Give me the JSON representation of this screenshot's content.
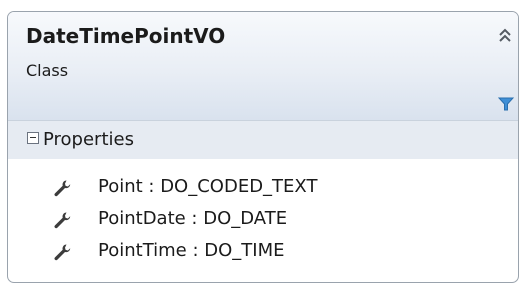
{
  "class": {
    "name": "DateTimePointVO",
    "stereotype": "Class"
  },
  "icons": {
    "collapse": "double-chevron-up-icon",
    "filter": "filter-icon",
    "section_toggle": "minus-box-icon",
    "property": "wrench-icon"
  },
  "colors": {
    "border": "#9aa3ad",
    "header_top": "#f7f9fc",
    "header_bottom": "#d9e2ee",
    "section_bg": "#e6ebf2",
    "filter_icon": "#3f8fd6",
    "text": "#1b1b1b"
  },
  "properties_section": {
    "title": "Properties",
    "items": [
      {
        "label": "Point : DO_CODED_TEXT"
      },
      {
        "label": "PointDate : DO_DATE"
      },
      {
        "label": "PointTime : DO_TIME"
      }
    ]
  }
}
